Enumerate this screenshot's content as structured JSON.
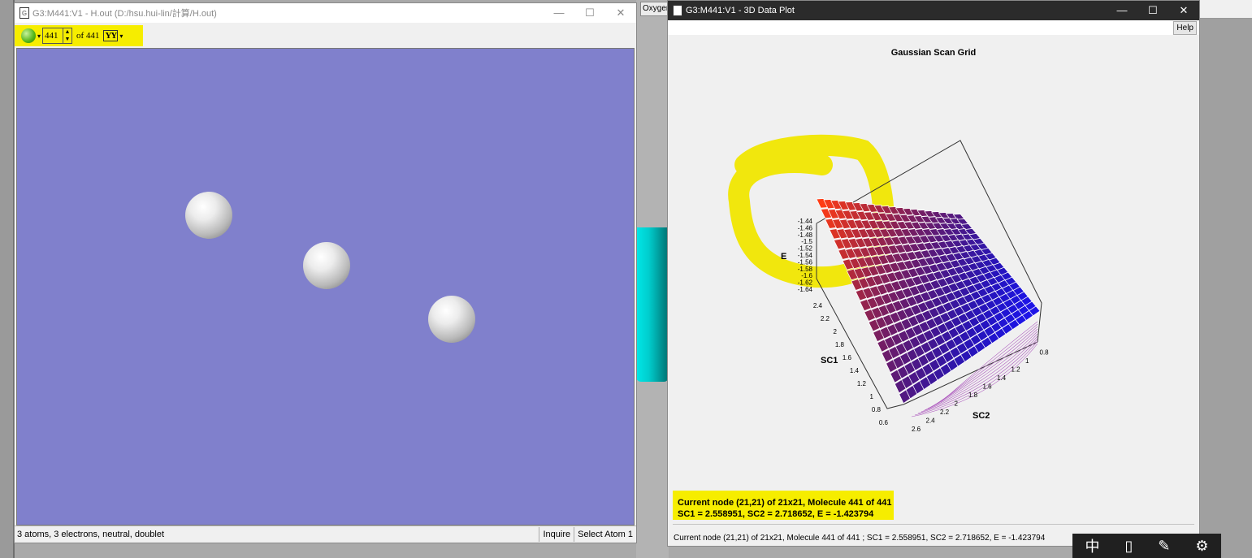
{
  "desktop": {
    "oxygen_tab": "Oxygen"
  },
  "left_window": {
    "title": "G3:M441:V1 - H.out (D:/hsu.hui-lin/計算/H.out)",
    "controls": {
      "minimize": "—",
      "maximize": "☐",
      "close": "✕"
    },
    "toolbar": {
      "frame_value": "441",
      "of_label": "of 441",
      "yy_label": "YY",
      "drop": "▾"
    },
    "status": {
      "summary": "3 atoms, 3 electrons, neutral, doublet",
      "inquire": "Inquire",
      "select_atom": "Select Atom 1"
    },
    "colors": {
      "viewport": "#8080cc",
      "highlight": "#f6ed00"
    }
  },
  "right_window": {
    "title": "G3:M441:V1 - 3D Data Plot",
    "controls": {
      "minimize": "—",
      "maximize": "☐",
      "close": "✕"
    },
    "help": "Help",
    "info_line1": "Current node (21,21) of 21x21, Molecule 441 of 441",
    "info_line2": "SC1 = 2.558951, SC2 = 2.718652, E = -1.423794",
    "bottom_status": "Current node (21,21) of 21x21, Molecule 441 of 441 ; SC1 = 2.558951, SC2 = 2.718652, E = -1.423794"
  },
  "chart_data": {
    "type": "surface",
    "title": "Gaussian Scan Grid",
    "zlabel": "E",
    "ylabel": "SC1",
    "xlabel": "SC2",
    "grid_size": "21x21",
    "z_ticks": [
      "-1.44",
      "-1.46",
      "-1.48",
      "-1.5",
      "-1.52",
      "-1.54",
      "-1.56",
      "-1.58",
      "-1.6",
      "-1.62",
      "-1.64"
    ],
    "sc1_ticks": [
      "2.4",
      "2.2",
      "2",
      "1.8",
      "1.6",
      "1.4",
      "1.2",
      "1",
      "0.8",
      "0.6"
    ],
    "sc2_ticks": [
      "2.6",
      "2.4",
      "2.2",
      "2",
      "1.8",
      "1.6",
      "1.4",
      "1.2",
      "1",
      "0.8"
    ],
    "current_node": {
      "sc1": 2.558951,
      "sc2": 2.718652,
      "e": -1.423794
    }
  },
  "taskbar": {
    "ime": "中",
    "icons": [
      "layout-icon",
      "pen-icon",
      "settings-icon"
    ]
  }
}
